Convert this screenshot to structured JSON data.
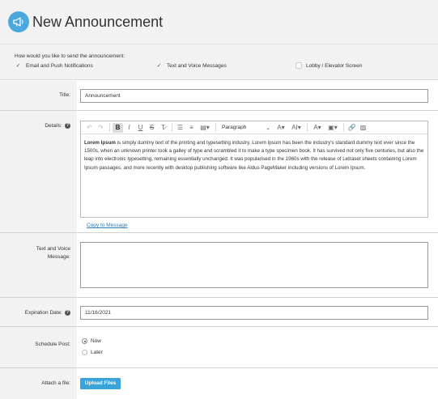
{
  "header": {
    "title": "New Announcement",
    "icon": "megaphone-icon",
    "accent": "#4aa8dc"
  },
  "send": {
    "question": "How would you like to send the announcement:",
    "options": [
      {
        "label": "Email and Push Notifications",
        "checked": true
      },
      {
        "label": "Text and Voice Messages",
        "checked": true
      },
      {
        "label": "Lobby / Elevator Screen",
        "checked": false
      }
    ]
  },
  "title_field": {
    "label": "Title:",
    "value": "Announcement"
  },
  "details": {
    "label": "Details:",
    "toolbar": {
      "paragraph": "Paragraph"
    },
    "body_bold": "Lorem Ipsum",
    "body_rest": " is simply dummy text of the printing and typesetting industry. Lorem Ipsum has been the industry's standard dummy text ever since the 1500s, when an unknown printer took a galley of type and scrambled it to make a type specimen book. It has survived not only five centuries, but also the leap into electronic typesetting, remaining essentially unchanged. It was popularised in the 1960s with the release of Letraset sheets containing Lorem Ipsum passages, and more recently with desktop publishing software like Aldus PageMaker including versions of Lorem Ipsum.",
    "copy_link": "Copy to Message"
  },
  "voice": {
    "label_line1": "Text and Voice",
    "label_line2": "Message:",
    "value": ""
  },
  "expiration": {
    "label": "Expiration Date:",
    "value": "11/16/2021"
  },
  "schedule": {
    "label": "Schedule Post:",
    "options": [
      {
        "label": "Now",
        "selected": true
      },
      {
        "label": "Later",
        "selected": false
      }
    ]
  },
  "attach": {
    "label": "Attach a file:",
    "button": "Upload Files",
    "button_color": "#3aa3db"
  }
}
